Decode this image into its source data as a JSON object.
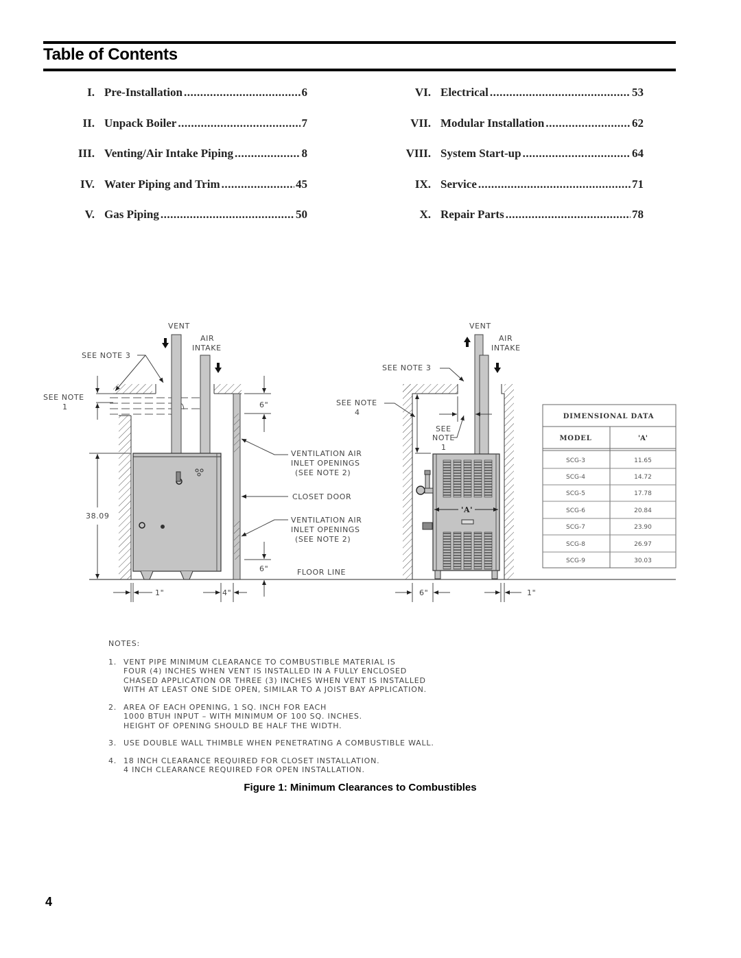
{
  "header": {
    "title": "Table of Contents"
  },
  "toc": {
    "left": [
      {
        "num": "I.",
        "label": "Pre-Installation",
        "page": "6"
      },
      {
        "num": "II.",
        "label": "Unpack Boiler",
        "page": "7"
      },
      {
        "num": "III.",
        "label": "Venting/Air Intake Piping",
        "page": "8"
      },
      {
        "num": "IV.",
        "label": "Water Piping and Trim",
        "page": "45"
      },
      {
        "num": "V.",
        "label": "Gas Piping",
        "page": "50"
      }
    ],
    "right": [
      {
        "num": "VI.",
        "label": "Electrical",
        "page": "53"
      },
      {
        "num": "VII.",
        "label": "Modular Installation",
        "page": "62"
      },
      {
        "num": "VIII.",
        "label": "System Start-up",
        "page": "64"
      },
      {
        "num": "IX.",
        "label": "Service",
        "page": "71"
      },
      {
        "num": "X.",
        "label": "Repair Parts",
        "page": "78"
      }
    ]
  },
  "figure": {
    "caption": "Figure 1:  Minimum Clearances to Combustibles",
    "labels": {
      "vent": "VENT",
      "air_1": "AIR",
      "air_2": "INTAKE",
      "see_note_3": "SEE NOTE 3",
      "see_note": "SEE NOTE",
      "note_1": "1",
      "note_4": "4",
      "see": "SEE",
      "note": "NOTE",
      "six_in": "6\"",
      "one_in": "1\"",
      "four_in": "4\"",
      "height": "38.09",
      "vent_air_1": "VENTILATION AIR",
      "vent_air_2": "INLET OPENINGS",
      "vent_air_3": "(SEE NOTE 2)",
      "closet_door": "CLOSET DOOR",
      "floor_line": "FLOOR LINE",
      "dim_a": "'A'"
    },
    "table": {
      "title": "DIMENSIONAL DATA",
      "headers": [
        "MODEL",
        "'A'"
      ],
      "rows": [
        [
          "SCG-3",
          "11.65"
        ],
        [
          "SCG-4",
          "14.72"
        ],
        [
          "SCG-5",
          "17.78"
        ],
        [
          "SCG-6",
          "20.84"
        ],
        [
          "SCG-7",
          "23.90"
        ],
        [
          "SCG-8",
          "26.97"
        ],
        [
          "SCG-9",
          "30.03"
        ]
      ]
    }
  },
  "notes": {
    "title": "NOTES:",
    "items": [
      {
        "num": "1.",
        "lines": [
          "VENT PIPE MINIMUM CLEARANCE TO COMBUSTIBLE MATERIAL IS",
          "FOUR (4) INCHES WHEN VENT IS INSTALLED IN A FULLY ENCLOSED",
          "CHASED APPLICATION OR THREE (3) INCHES WHEN VENT IS INSTALLED",
          "WITH AT LEAST ONE SIDE OPEN, SIMILAR TO A JOIST BAY APPLICATION."
        ]
      },
      {
        "num": "2.",
        "lines": [
          "AREA OF EACH OPENING, 1 SQ. INCH FOR EACH",
          "1000 BTUH INPUT – WITH MINIMUM OF 100 SQ. INCHES.",
          "HEIGHT OF OPENING SHOULD BE HALF THE WIDTH."
        ]
      },
      {
        "num": "3.",
        "lines": [
          "USE DOUBLE WALL THIMBLE WHEN PENETRATING A COMBUSTIBLE WALL."
        ]
      },
      {
        "num": "4.",
        "lines": [
          "18 INCH CLEARANCE REQUIRED FOR CLOSET INSTALLATION.",
          "4 INCH CLEARANCE REQUIRED FOR OPEN INSTALLATION."
        ]
      }
    ]
  },
  "footer": {
    "page_number": "4"
  }
}
